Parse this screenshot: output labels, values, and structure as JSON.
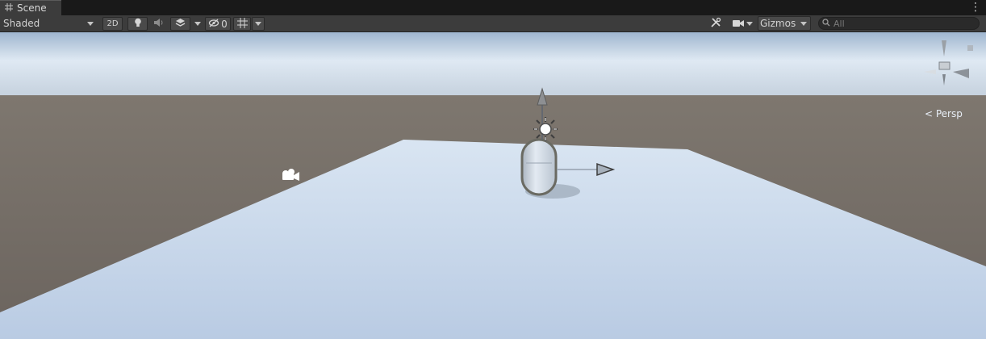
{
  "tab": {
    "title": "Scene"
  },
  "toolbar": {
    "shading_mode": "Shaded",
    "mode_2d": "2D",
    "hidden_count": "0",
    "gizmos_label": "Gizmos",
    "search_placeholder": "All"
  },
  "orientation": {
    "projection_label": "< Persp"
  },
  "colors": {
    "sky_top": "#dbe6f2",
    "horizon": "#b7c7da",
    "ground": "#6e6863",
    "plane": "#cbd9ec",
    "capsule": "#d4dde9"
  }
}
